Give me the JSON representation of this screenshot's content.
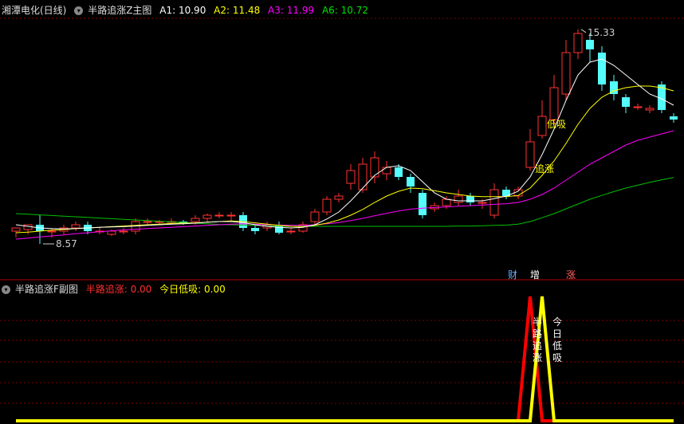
{
  "main_header": {
    "stock_name": "湘潭电化(日线)",
    "indicator_name": "半路追涨Z主图",
    "a1_label": "A1: ",
    "a1_value": "10.90",
    "a2_label": "A2: ",
    "a2_value": "11.48",
    "a3_label": "A3: ",
    "a3_value": "11.99",
    "a6_label": "A6: ",
    "a6_value": "10.72"
  },
  "sub_header": {
    "indicator_name": "半路追涨F副图",
    "s1_label": "半路追涨: ",
    "s1_value": "0.00",
    "s2_label": "今日低吸: ",
    "s2_value": "0.00"
  },
  "badges": {
    "cai": "财",
    "zeng": "增",
    "zhang": "涨"
  },
  "colors": {
    "up": "#ff3232",
    "down": "#54fcfc",
    "grid": "#7a0000",
    "a1": "#ffffff",
    "a2": "#ffff00",
    "a3": "#ff00ff",
    "a6": "#00c000",
    "s1": "#ff0000",
    "s2": "#ffff00"
  },
  "chart_data": [
    {
      "type": "candlestick",
      "high_label": "15.33",
      "low_label": "8.57",
      "annotations": [
        {
          "text": "低吸",
          "bar": 44
        },
        {
          "text": "追涨",
          "bar": 43
        }
      ],
      "ylim": [
        8.0,
        15.8
      ],
      "ohlc": [
        [
          9.0,
          9.1,
          8.8,
          9.0
        ],
        [
          9.05,
          9.2,
          8.9,
          9.1
        ],
        [
          9.2,
          9.0,
          8.6,
          9.5
        ],
        [
          9.0,
          9.0,
          8.8,
          9.1
        ],
        [
          9.0,
          9.1,
          8.9,
          9.2
        ],
        [
          9.1,
          9.2,
          9.0,
          9.3
        ],
        [
          9.2,
          9.0,
          8.9,
          9.3
        ],
        [
          9.0,
          9.0,
          8.9,
          9.1
        ],
        [
          8.9,
          9.0,
          8.85,
          9.05
        ],
        [
          9.0,
          9.0,
          8.9,
          9.1
        ],
        [
          9.0,
          9.3,
          8.9,
          9.4
        ],
        [
          9.3,
          9.3,
          9.2,
          9.4
        ],
        [
          9.3,
          9.3,
          9.2,
          9.35
        ],
        [
          9.3,
          9.3,
          9.2,
          9.4
        ],
        [
          9.3,
          9.25,
          9.2,
          9.35
        ],
        [
          9.3,
          9.4,
          9.2,
          9.5
        ],
        [
          9.4,
          9.5,
          9.3,
          9.55
        ],
        [
          9.5,
          9.5,
          9.4,
          9.6
        ],
        [
          9.5,
          9.5,
          9.3,
          9.6
        ],
        [
          9.5,
          9.1,
          9.0,
          9.6
        ],
        [
          9.1,
          9.0,
          8.9,
          9.2
        ],
        [
          9.1,
          9.2,
          9.0,
          9.3
        ],
        [
          9.2,
          8.95,
          8.9,
          9.3
        ],
        [
          9.0,
          9.0,
          8.9,
          9.1
        ],
        [
          9.0,
          9.2,
          8.95,
          9.3
        ],
        [
          9.3,
          9.6,
          9.2,
          9.7
        ],
        [
          9.6,
          10.0,
          9.5,
          10.1
        ],
        [
          10.0,
          10.1,
          9.9,
          10.2
        ],
        [
          10.5,
          10.9,
          10.3,
          11.1
        ],
        [
          10.3,
          11.1,
          10.2,
          11.3
        ],
        [
          10.7,
          11.3,
          10.5,
          11.5
        ],
        [
          10.8,
          11.0,
          10.6,
          11.2
        ],
        [
          11.0,
          10.7,
          10.6,
          11.1
        ],
        [
          10.7,
          10.4,
          10.2,
          10.8
        ],
        [
          10.2,
          9.5,
          9.4,
          10.3
        ],
        [
          9.7,
          9.8,
          9.6,
          9.9
        ],
        [
          9.8,
          10.0,
          9.7,
          10.1
        ],
        [
          9.9,
          10.1,
          9.8,
          10.3
        ],
        [
          10.1,
          9.9,
          9.8,
          10.2
        ],
        [
          9.9,
          9.9,
          9.7,
          10.0
        ],
        [
          9.5,
          10.3,
          9.4,
          10.5
        ],
        [
          10.3,
          10.1,
          10.0,
          10.4
        ],
        [
          10.1,
          10.3,
          10.0,
          10.4
        ],
        [
          11.0,
          11.8,
          10.9,
          12.2
        ],
        [
          12.0,
          12.6,
          11.9,
          13.1
        ],
        [
          12.5,
          13.5,
          12.3,
          13.9
        ],
        [
          13.3,
          14.6,
          13.1,
          15.0
        ],
        [
          14.6,
          15.2,
          14.4,
          15.33
        ],
        [
          15.0,
          14.7,
          14.3,
          15.2
        ],
        [
          14.6,
          13.6,
          13.4,
          14.8
        ],
        [
          13.7,
          13.3,
          13.1,
          13.9
        ],
        [
          13.2,
          12.9,
          12.7,
          13.3
        ],
        [
          12.9,
          12.9,
          12.8,
          13.0
        ],
        [
          12.8,
          12.85,
          12.7,
          12.95
        ],
        [
          13.6,
          12.8,
          12.7,
          13.7
        ],
        [
          12.6,
          12.5,
          12.4,
          12.7
        ]
      ],
      "a1": [
        9.2,
        9.15,
        9.1,
        9.08,
        9.07,
        9.08,
        9.1,
        9.12,
        9.13,
        9.14,
        9.16,
        9.18,
        9.2,
        9.22,
        9.23,
        9.25,
        9.28,
        9.3,
        9.3,
        9.27,
        9.2,
        9.15,
        9.12,
        9.1,
        9.12,
        9.2,
        9.38,
        9.6,
        9.95,
        10.35,
        10.75,
        11.0,
        11.05,
        10.9,
        10.55,
        10.2,
        10.0,
        9.95,
        9.95,
        9.95,
        10.02,
        10.1,
        10.25,
        10.7,
        11.4,
        12.2,
        13.1,
        13.9,
        14.3,
        14.4,
        14.2,
        13.9,
        13.6,
        13.3,
        13.15,
        12.95
      ],
      "a2": [
        8.95,
        8.97,
        9.0,
        9.03,
        9.05,
        9.08,
        9.1,
        9.12,
        9.14,
        9.16,
        9.18,
        9.2,
        9.22,
        9.24,
        9.25,
        9.26,
        9.28,
        9.3,
        9.32,
        9.3,
        9.26,
        9.22,
        9.18,
        9.15,
        9.14,
        9.18,
        9.25,
        9.35,
        9.5,
        9.68,
        9.9,
        10.1,
        10.25,
        10.35,
        10.33,
        10.27,
        10.2,
        10.15,
        10.1,
        10.08,
        10.08,
        10.08,
        10.12,
        10.35,
        10.75,
        11.2,
        11.75,
        12.35,
        12.85,
        13.2,
        13.4,
        13.5,
        13.55,
        13.55,
        13.5,
        13.4
      ],
      "a3": [
        8.75,
        8.78,
        8.82,
        8.85,
        8.88,
        8.92,
        8.95,
        8.98,
        9.01,
        9.04,
        9.06,
        9.08,
        9.1,
        9.12,
        9.14,
        9.16,
        9.18,
        9.2,
        9.22,
        9.23,
        9.22,
        9.2,
        9.19,
        9.18,
        9.18,
        9.2,
        9.23,
        9.27,
        9.33,
        9.4,
        9.48,
        9.56,
        9.63,
        9.69,
        9.72,
        9.74,
        9.76,
        9.78,
        9.8,
        9.82,
        9.84,
        9.86,
        9.9,
        10.0,
        10.15,
        10.35,
        10.6,
        10.85,
        11.1,
        11.3,
        11.5,
        11.7,
        11.85,
        11.95,
        12.05,
        12.15
      ],
      "a6": [
        9.55,
        9.53,
        9.51,
        9.49,
        9.47,
        9.45,
        9.43,
        9.41,
        9.39,
        9.37,
        9.35,
        9.33,
        9.31,
        9.29,
        9.27,
        9.25,
        9.23,
        9.21,
        9.2,
        9.19,
        9.18,
        9.17,
        9.16,
        9.15,
        9.15,
        9.15,
        9.15,
        9.15,
        9.15,
        9.15,
        9.15,
        9.15,
        9.15,
        9.15,
        9.15,
        9.15,
        9.15,
        9.16,
        9.16,
        9.17,
        9.18,
        9.19,
        9.22,
        9.3,
        9.42,
        9.55,
        9.7,
        9.85,
        10.0,
        10.12,
        10.24,
        10.35,
        10.44,
        10.53,
        10.61,
        10.68
      ]
    },
    {
      "type": "line",
      "series": [
        {
          "name": "半路追涨",
          "values": [
            0,
            0,
            0,
            0,
            0,
            0,
            0,
            0,
            0,
            0,
            0,
            0,
            0,
            0,
            0,
            0,
            0,
            0,
            0,
            0,
            0,
            0,
            0,
            0,
            0,
            0,
            0,
            0,
            0,
            0,
            0,
            0,
            0,
            0,
            0,
            0,
            0,
            0,
            0,
            0,
            0,
            0,
            0,
            1,
            0,
            0,
            0,
            0,
            0,
            0,
            0,
            0,
            0,
            0,
            0,
            0
          ]
        },
        {
          "name": "今日低吸",
          "values": [
            0,
            0,
            0,
            0,
            0,
            0,
            0,
            0,
            0,
            0,
            0,
            0,
            0,
            0,
            0,
            0,
            0,
            0,
            0,
            0,
            0,
            0,
            0,
            0,
            0,
            0,
            0,
            0,
            0,
            0,
            0,
            0,
            0,
            0,
            0,
            0,
            0,
            0,
            0,
            0,
            0,
            0,
            0,
            0,
            1,
            0,
            0,
            0,
            0,
            0,
            0,
            0,
            0,
            0,
            0,
            0
          ]
        }
      ],
      "ylim": [
        0,
        1
      ]
    }
  ]
}
